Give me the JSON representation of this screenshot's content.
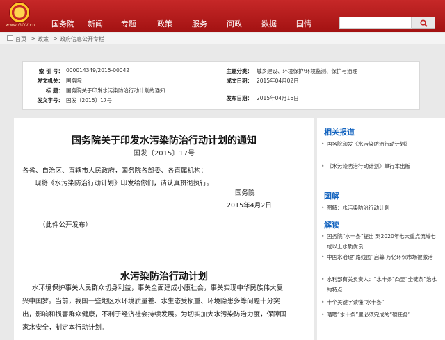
{
  "header": {
    "logo_text": "www.GOV.cn",
    "nav": [
      "国务院",
      "新闻",
      "专题",
      "政策",
      "服务",
      "问政",
      "数据",
      "国情"
    ],
    "search_placeholder": "",
    "search_icon": "search-icon",
    "brand_color": "#b71c1c"
  },
  "breadcrumb": {
    "items": [
      "首页",
      "政策",
      "政府信息公开专栏"
    ],
    "separator": ">"
  },
  "meta": {
    "left": [
      {
        "label": "索 引 号：",
        "value": "000014349/2015-00042"
      },
      {
        "label": "发文机关：",
        "value": "国务院"
      },
      {
        "label": "标 题：",
        "value": "国务院关于印发水污染防治行动计划的通知"
      },
      {
        "label": "发文字号：",
        "value": "国发〔2015〕17号"
      }
    ],
    "right": [
      {
        "label": "主题分类：",
        "value": "城乡建设、环境保护\\环境监测、保护与治理"
      },
      {
        "label": "成文日期：",
        "value": "2015年04月02日"
      },
      {
        "label": "发布日期：",
        "value": "2015年04月16日"
      }
    ]
  },
  "article": {
    "title": "国务院关于印发水污染防治行动计划的通知",
    "number": "国发〔2015〕17号",
    "salutation": "各省、自治区、直辖市人民政府，国务院各部委、各直属机构：",
    "body1": "现将《水污染防治行动计划》印发给你们，请认真贯彻执行。",
    "signature": "国务院",
    "date": "2015年4月2日",
    "note": "（此件公开发布）",
    "plan_title": "水污染防治行动计划",
    "plan_lines": [
      "水环境保护事关人民群众切身利益，事关全面建成小康社会，事关实现中华民族伟大复",
      "兴中国梦。当前，我国一些地区水环境质量差、水生态受损重、环境隐患多等问题十分突",
      "出，影响和损害群众健康，不利于经济社会持续发展。为切实加大水污染防治力度，保障国",
      "家水安全，制定本行动计划。"
    ]
  },
  "sidebar": {
    "related_title": "相关报道",
    "related": [
      "国务院印发《水污染防治行动计划》",
      "《水污染防治行动计划》单行本出版"
    ],
    "graphic_title": "图解",
    "graphic": [
      "图解：水污染防治行动计划"
    ],
    "interpret_title": "解读",
    "interpret": [
      "国务院“水十条”提出 到2020年七大重点流域七成以上水质优良",
      "中国水治理“路线图”启幕 万亿环保市场被激活",
      "水利部有关负责人：“水十条”凸显“全链条”治水的特点",
      "十个关键字读懂“水十条”",
      "晒晒“水十条”里必须完成的“硬任务”"
    ]
  }
}
